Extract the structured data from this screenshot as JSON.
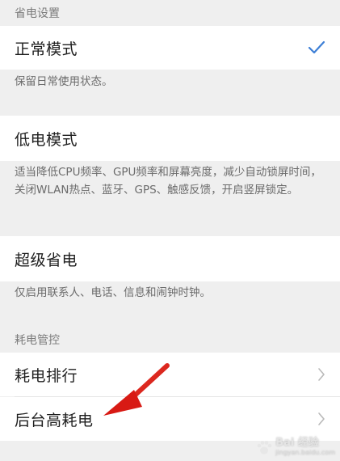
{
  "sections": {
    "power_saving_header": "省电设置",
    "power_consumption_header": "耗电管控"
  },
  "modes": {
    "normal": {
      "title": "正常模式",
      "desc": "保留日常使用状态。",
      "selected": true
    },
    "low_power": {
      "title": "低电模式",
      "desc": "适当降低CPU频率、GPU频率和屏幕亮度，减少自动锁屏时间，关闭WLAN热点、蓝牙、GPS、触感反馈，开启竖屏锁定。"
    },
    "super_saver": {
      "title": "超级省电",
      "desc": "仅启用联系人、电话、信息和闹钟时钟。"
    }
  },
  "consumption": {
    "ranking": {
      "title": "耗电排行"
    },
    "background_high": {
      "title": "后台高耗电"
    }
  },
  "watermark": {
    "main": "Bai 经验",
    "sub": "jingyan.baidu.com"
  },
  "colors": {
    "accent_check": "#3d7fd6",
    "annotation_arrow": "#e0201b",
    "background": "#efefef",
    "row_background": "#ffffff"
  },
  "icons": {
    "selected": "check-icon",
    "navigate": "chevron-right-icon",
    "annotation": "red-arrow-icon"
  }
}
